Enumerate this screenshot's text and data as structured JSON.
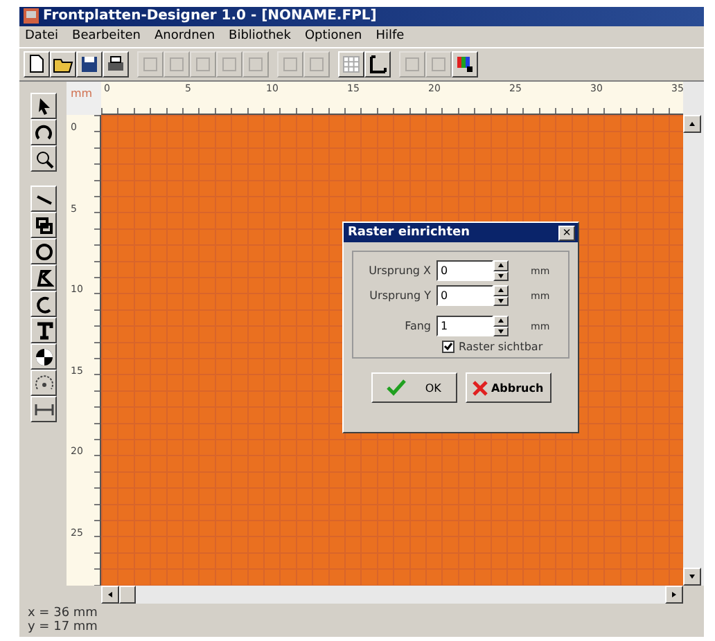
{
  "window": {
    "title": "Frontplatten-Designer 1.0 - [NONAME.FPL]"
  },
  "menu": [
    {
      "label": "Datei"
    },
    {
      "label": "Bearbeiten"
    },
    {
      "label": "Anordnen"
    },
    {
      "label": "Bibliothek"
    },
    {
      "label": "Optionen"
    },
    {
      "label": "Hilfe"
    }
  ],
  "toolbar": [
    [
      {
        "kind": "new",
        "disabled": false
      },
      {
        "kind": "open",
        "disabled": false
      },
      {
        "kind": "save",
        "disabled": false
      },
      {
        "kind": "print",
        "disabled": false
      }
    ],
    [
      {
        "kind": "cut",
        "disabled": true
      },
      {
        "kind": "scissors",
        "disabled": true
      },
      {
        "kind": "copy",
        "disabled": true
      },
      {
        "kind": "paste",
        "disabled": true
      },
      {
        "kind": "delete",
        "disabled": true
      }
    ],
    [
      {
        "kind": "lock",
        "disabled": true
      },
      {
        "kind": "unlock",
        "disabled": true
      }
    ],
    [
      {
        "kind": "grid",
        "disabled": false
      },
      {
        "kind": "dimension",
        "disabled": false
      }
    ],
    [
      {
        "kind": "align-v",
        "disabled": true
      },
      {
        "kind": "align-h",
        "disabled": true
      },
      {
        "kind": "color",
        "disabled": false
      }
    ]
  ],
  "tools": [
    [
      {
        "kind": "pointer"
      },
      {
        "kind": "rotate"
      },
      {
        "kind": "zoom"
      }
    ],
    [
      {
        "kind": "line"
      },
      {
        "kind": "rect"
      },
      {
        "kind": "circle"
      },
      {
        "kind": "polygon"
      },
      {
        "kind": "arc"
      },
      {
        "kind": "text"
      },
      {
        "kind": "pie"
      },
      {
        "kind": "dial"
      },
      {
        "kind": "measure"
      }
    ]
  ],
  "ruler": {
    "unit": "mm",
    "x_labels": [
      "0",
      "5",
      "10",
      "15",
      "20",
      "25",
      "30",
      "35"
    ],
    "y_labels": [
      "0",
      "5",
      "10",
      "15",
      "20",
      "25"
    ]
  },
  "dialog": {
    "title": "Raster einrichten",
    "close": "×",
    "fields": [
      {
        "label": "Ursprung X",
        "value": "0",
        "unit": "mm"
      },
      {
        "label": "Ursprung Y",
        "value": "0",
        "unit": "mm"
      },
      {
        "label": "Fang",
        "value": "1",
        "unit": "mm"
      }
    ],
    "checkbox": {
      "label": "Raster sichtbar",
      "checked": true
    },
    "buttons": [
      {
        "kind": "ok",
        "label": "OK"
      },
      {
        "kind": "cancel",
        "label": "Abbruch"
      }
    ]
  },
  "status_bar": [
    "x = 36 mm",
    "y = 17 mm"
  ]
}
